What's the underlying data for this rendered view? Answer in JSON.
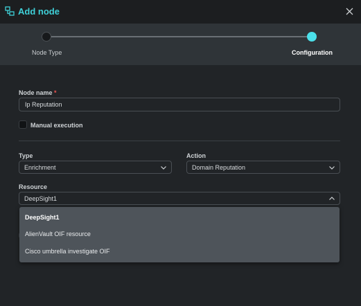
{
  "header": {
    "title": "Add node"
  },
  "stepper": {
    "steps": [
      {
        "label": "Node Type",
        "state": "done"
      },
      {
        "label": "Configuration",
        "state": "active"
      }
    ]
  },
  "form": {
    "node_name": {
      "label": "Node name",
      "required_mark": "*",
      "value": "Ip Reputation"
    },
    "manual_execution": {
      "label": "Manual execution",
      "checked": false
    },
    "type": {
      "label": "Type",
      "value": "Enrichment"
    },
    "action": {
      "label": "Action",
      "value": "Domain Reputation"
    },
    "resource": {
      "label": "Resource",
      "value": "DeepSight1",
      "expanded": true
    }
  },
  "resource_dropdown": {
    "options": [
      {
        "label": "DeepSight1",
        "selected": true
      },
      {
        "label": "AlienVault OIF resource",
        "selected": false
      },
      {
        "label": "Cisco umbrella investigate OIF",
        "selected": false
      }
    ]
  },
  "colors": {
    "accent": "#3fd0d8",
    "active_step": "#4be0ea",
    "required": "#ef5350",
    "background": "#212427"
  }
}
